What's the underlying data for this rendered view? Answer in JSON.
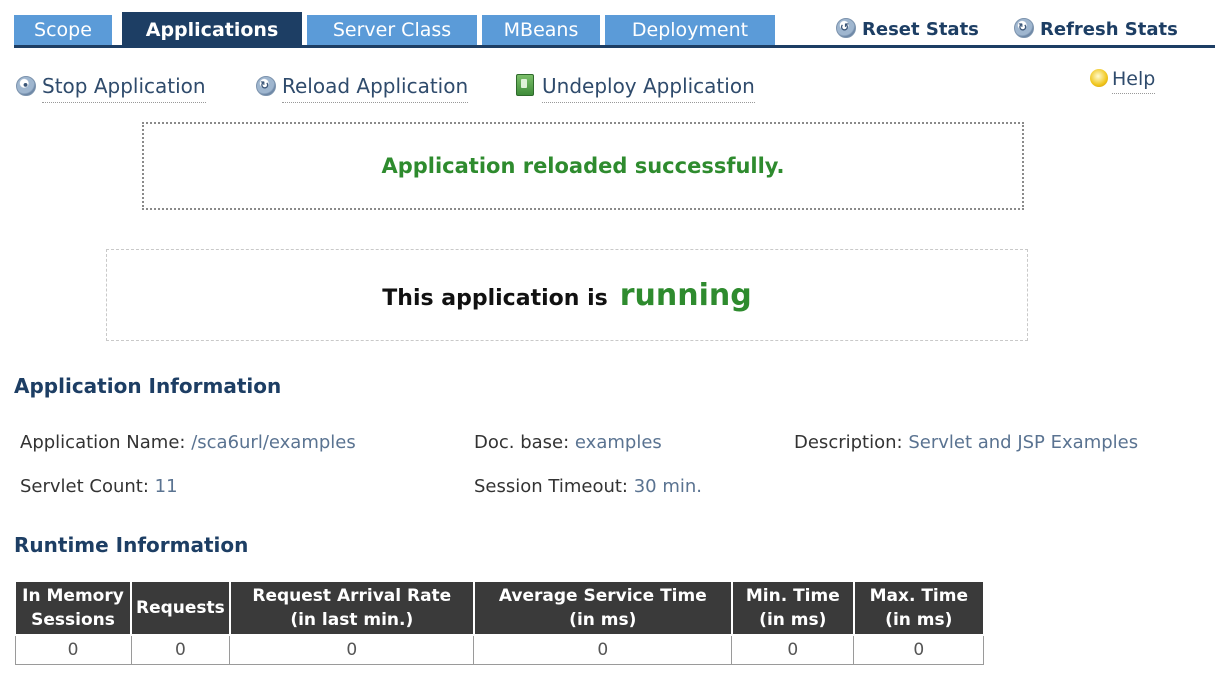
{
  "tabs": [
    {
      "label": "Scope",
      "active": false
    },
    {
      "label": "Applications",
      "active": true
    },
    {
      "label": "Server Class",
      "active": false
    },
    {
      "label": "MBeans",
      "active": false
    },
    {
      "label": "Deployment",
      "active": false
    }
  ],
  "stats": {
    "reset_label": "Reset Stats",
    "refresh_label": "Refresh Stats"
  },
  "actions": {
    "stop_label": "Stop Application",
    "reload_label": "Reload Application",
    "undeploy_label": "Undeploy Application",
    "help_label": "Help"
  },
  "message": {
    "text": "Application reloaded successfully."
  },
  "status": {
    "prefix": "This application is",
    "state": "running"
  },
  "application_info": {
    "title": "Application Information",
    "name_label": "Application Name:",
    "name_value": "/sca6url/examples",
    "docbase_label": "Doc. base:",
    "docbase_value": "examples",
    "description_label": "Description:",
    "description_value": "Servlet and JSP Examples",
    "servlet_count_label": "Servlet Count:",
    "servlet_count_value": "11",
    "session_timeout_label": "Session Timeout:",
    "session_timeout_value": "30 min."
  },
  "runtime_info": {
    "title": "Runtime Information",
    "columns": [
      {
        "line1": "In Memory",
        "line2": "Sessions"
      },
      {
        "line1": "Requests",
        "line2": ""
      },
      {
        "line1": "Request Arrival Rate",
        "line2": "(in last min.)"
      },
      {
        "line1": "Average Service Time",
        "line2": "(in ms)"
      },
      {
        "line1": "Min. Time",
        "line2": "(in ms)"
      },
      {
        "line1": "Max. Time",
        "line2": "(in ms)"
      }
    ],
    "row": [
      "0",
      "0",
      "0",
      "0",
      "0",
      "0"
    ]
  },
  "colors": {
    "tab_inactive": "#5b9bd8",
    "tab_active": "#1d3e64",
    "success_green": "#2e8b2e",
    "table_header": "#3a3a3a"
  }
}
